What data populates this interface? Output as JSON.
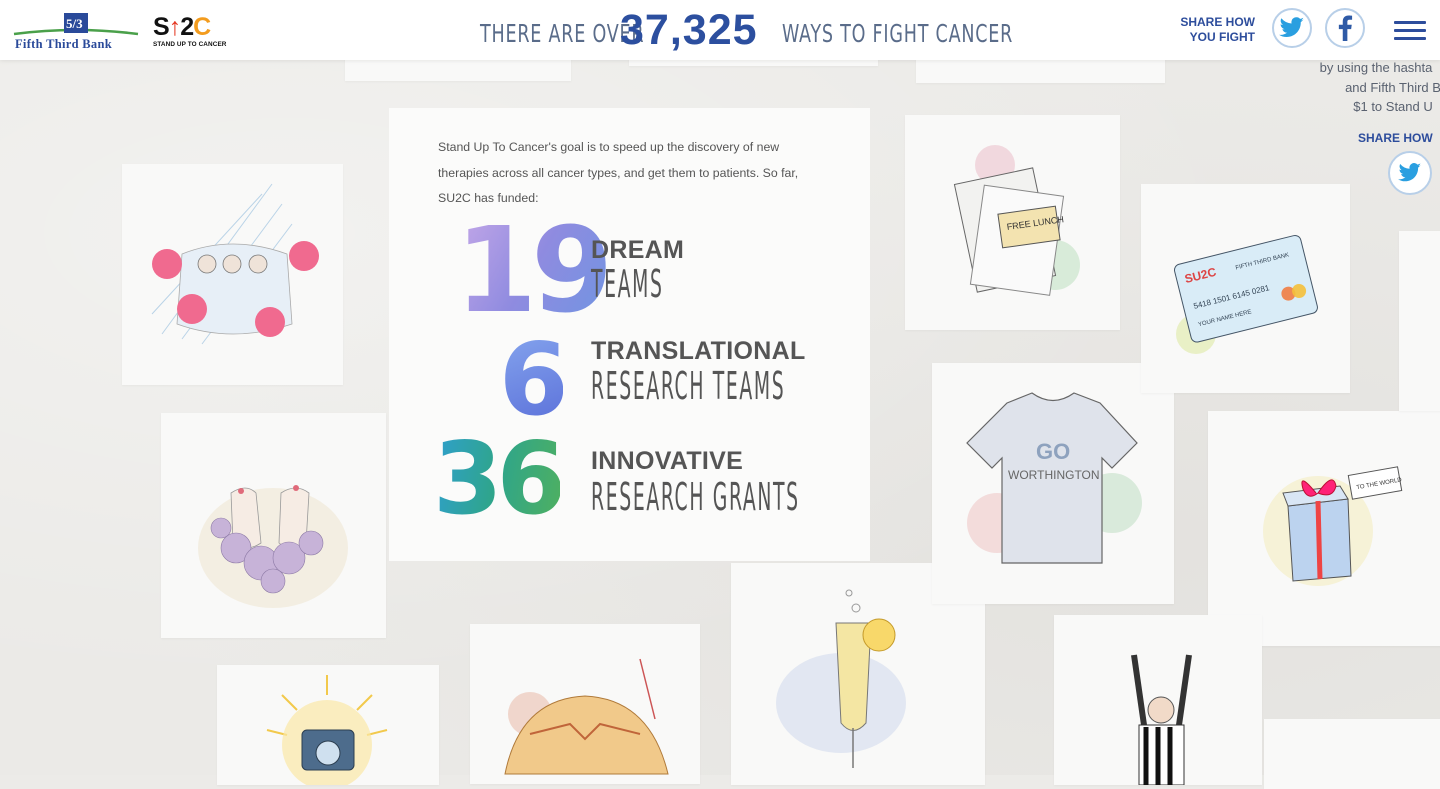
{
  "header": {
    "bank_name": "Fifth Third Bank",
    "su2c": {
      "s": "S",
      "arrow": "↑",
      "two": "2",
      "c": "C",
      "tagline": "STAND UP TO CANCER"
    },
    "headline_pre": "THERE ARE OVER",
    "count": "37,325",
    "headline_post": "WAYS TO FIGHT CANCER",
    "share_line1": "SHARE HOW",
    "share_line2": "YOU FIGHT",
    "menu_icon": "hamburger-icon"
  },
  "stats_card": {
    "intro": "Stand Up To Cancer's goal is to speed up the discovery of new therapies across all cancer types, and get them to patients. So far, SU2C has funded:",
    "stats": [
      {
        "number": "19",
        "title": "DREAM",
        "subtitle": "TEAMS"
      },
      {
        "number": "6",
        "title": "TRANSLATIONAL",
        "subtitle": "RESEARCH TEAMS"
      },
      {
        "number": "36",
        "title": "INNOVATIVE",
        "subtitle": "RESEARCH GRANTS"
      }
    ]
  },
  "side_panel": {
    "line1": "by using the hashta",
    "line2": "and Fifth Third B",
    "line3": "$1 to Stand U",
    "share": "SHARE HOW"
  },
  "card_labels": {
    "lunch_ticket": "FREE LUNCH",
    "shirt_text_top": "GO",
    "shirt_text_bottom": "WORTHINGTON",
    "gift_tag": "TO THE WORLD",
    "credit_card_brand": "SU2C",
    "credit_card_bank": "FIFTH THIRD BANK",
    "credit_card_number": "5418 1501 6145 0281",
    "credit_card_name": "YOUR NAME HERE"
  },
  "colors": {
    "brand_blue": "#2c4f9f",
    "su2c_red": "#e53a24",
    "su2c_orange": "#f39c1e",
    "twitter_blue": "#2a9fe0",
    "facebook_blue": "#2e5aa6"
  }
}
